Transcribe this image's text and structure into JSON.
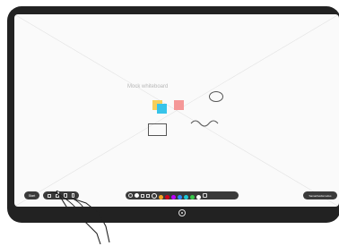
{
  "whiteboard": {
    "label": "Mock whiteboard"
  },
  "toolbar": {
    "start_label": "Start",
    "collaborate_label": "Samarbeidsmodus",
    "colors": [
      "#f5a623",
      "#d0021b",
      "#c000ff",
      "#2d8cff",
      "#1cc9d6",
      "#37c94a",
      "#ffffff"
    ]
  },
  "stickies": {
    "colors": [
      "#f7cf5a",
      "#37c4ea",
      "#f59898"
    ]
  },
  "icons": [
    "camera-icon",
    "home-button-icon",
    "pen-icon",
    "undo-icon",
    "trash-icon"
  ]
}
